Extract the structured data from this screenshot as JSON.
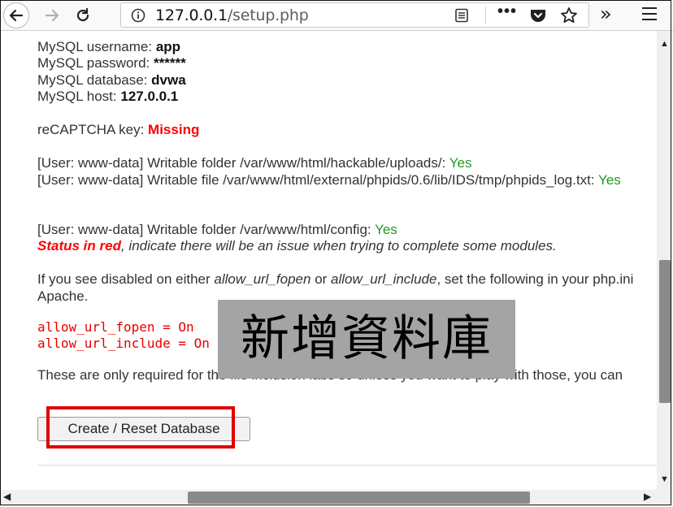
{
  "browser": {
    "url_host": "127.0.0.1",
    "url_path": "/setup.php",
    "more_label": "•••",
    "overflow_label": "»"
  },
  "config": {
    "username_label": "MySQL username: ",
    "username_value": "app",
    "password_label": "MySQL password: ",
    "password_value": "******",
    "database_label": "MySQL database: ",
    "database_value": "dvwa",
    "host_label": "MySQL host: ",
    "host_value": "127.0.0.1"
  },
  "recaptcha": {
    "label": "reCAPTCHA key: ",
    "value": "Missing"
  },
  "checks": [
    {
      "text": "[User: www-data] Writable folder /var/www/html/hackable/uploads/: ",
      "status": "Yes"
    },
    {
      "text": "[User: www-data] Writable file /var/www/html/external/phpids/0.6/lib/IDS/tmp/phpids_log.txt: ",
      "status": "Yes"
    },
    {
      "text": "[User: www-data] Writable folder /var/www/html/config: ",
      "status": "Yes"
    }
  ],
  "status_note": {
    "red_part": "Status in red",
    "rest": ", indicate there will be an issue when trying to complete some modules."
  },
  "php_note": {
    "prefix": "If you see disabled on either ",
    "opt1": "allow_url_fopen",
    "mid": " or ",
    "opt2": "allow_url_include",
    "suffix": ", set the following in your php.ini",
    "line2": "Apache."
  },
  "code_lines": [
    "allow_url_fopen = On",
    "allow_url_include = On"
  ],
  "required_note": "These are only required for the file inclusion labs so unless you want to play with those, you can",
  "create_button_label": "Create / Reset Database",
  "overlay_caption": "新增資料庫",
  "colors": {
    "highlight": "#e00000",
    "status_ok": "#1f9a1f",
    "status_bad": "#ff0000"
  }
}
